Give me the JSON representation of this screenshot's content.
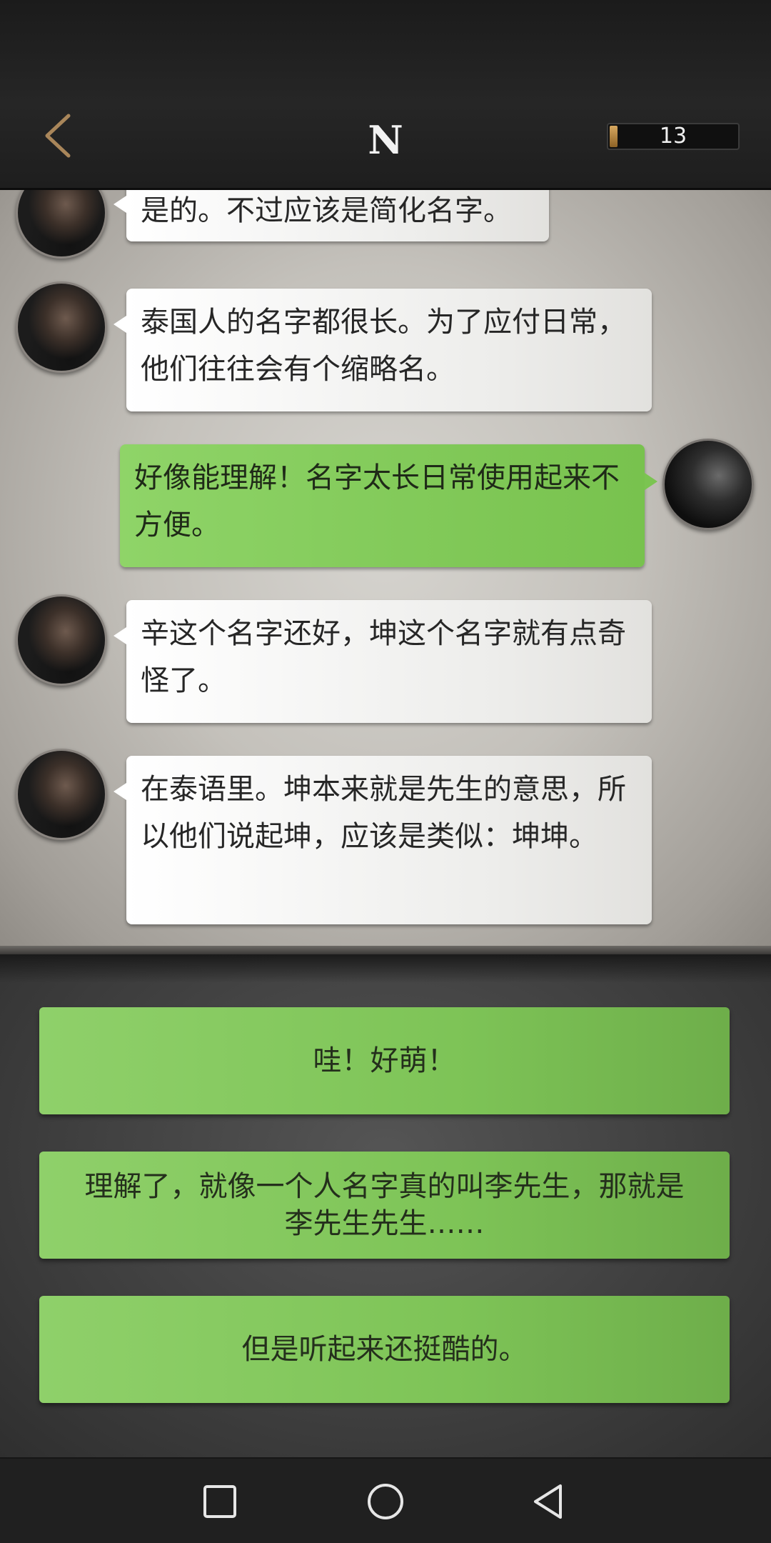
{
  "header": {
    "back_icon": "chevron-left-icon",
    "title": "N",
    "energy": {
      "count": "13",
      "level": 0.06,
      "fill_color": "#c08a40"
    }
  },
  "messages": [
    {
      "side": "left",
      "text": "是的。不过应该是简化名字。"
    },
    {
      "side": "left",
      "text": "泰国人的名字都很长。为了应付日常，他们往往会有个缩略名。"
    },
    {
      "side": "right",
      "text": "好像能理解！名字太长日常使用起来不方便。"
    },
    {
      "side": "left",
      "text": "辛这个名字还好，坤这个名字就有点奇怪了。"
    },
    {
      "side": "left",
      "text": "在泰语里。坤本来就是先生的意思，所以他们说起坤，应该是类似：坤坤。"
    }
  ],
  "options": [
    {
      "label": "哇！好萌！"
    },
    {
      "label": "理解了，就像一个人名字真的叫李先生，那就是李先生先生……"
    },
    {
      "label": "但是听起来还挺酷的。"
    }
  ],
  "colors": {
    "option_green": "#82c75a",
    "self_bubble_green": "#84cb5b",
    "other_bubble": "#f4f4f2"
  },
  "navbar": {
    "icons": [
      "recents-square-icon",
      "home-circle-icon",
      "back-triangle-icon"
    ]
  }
}
